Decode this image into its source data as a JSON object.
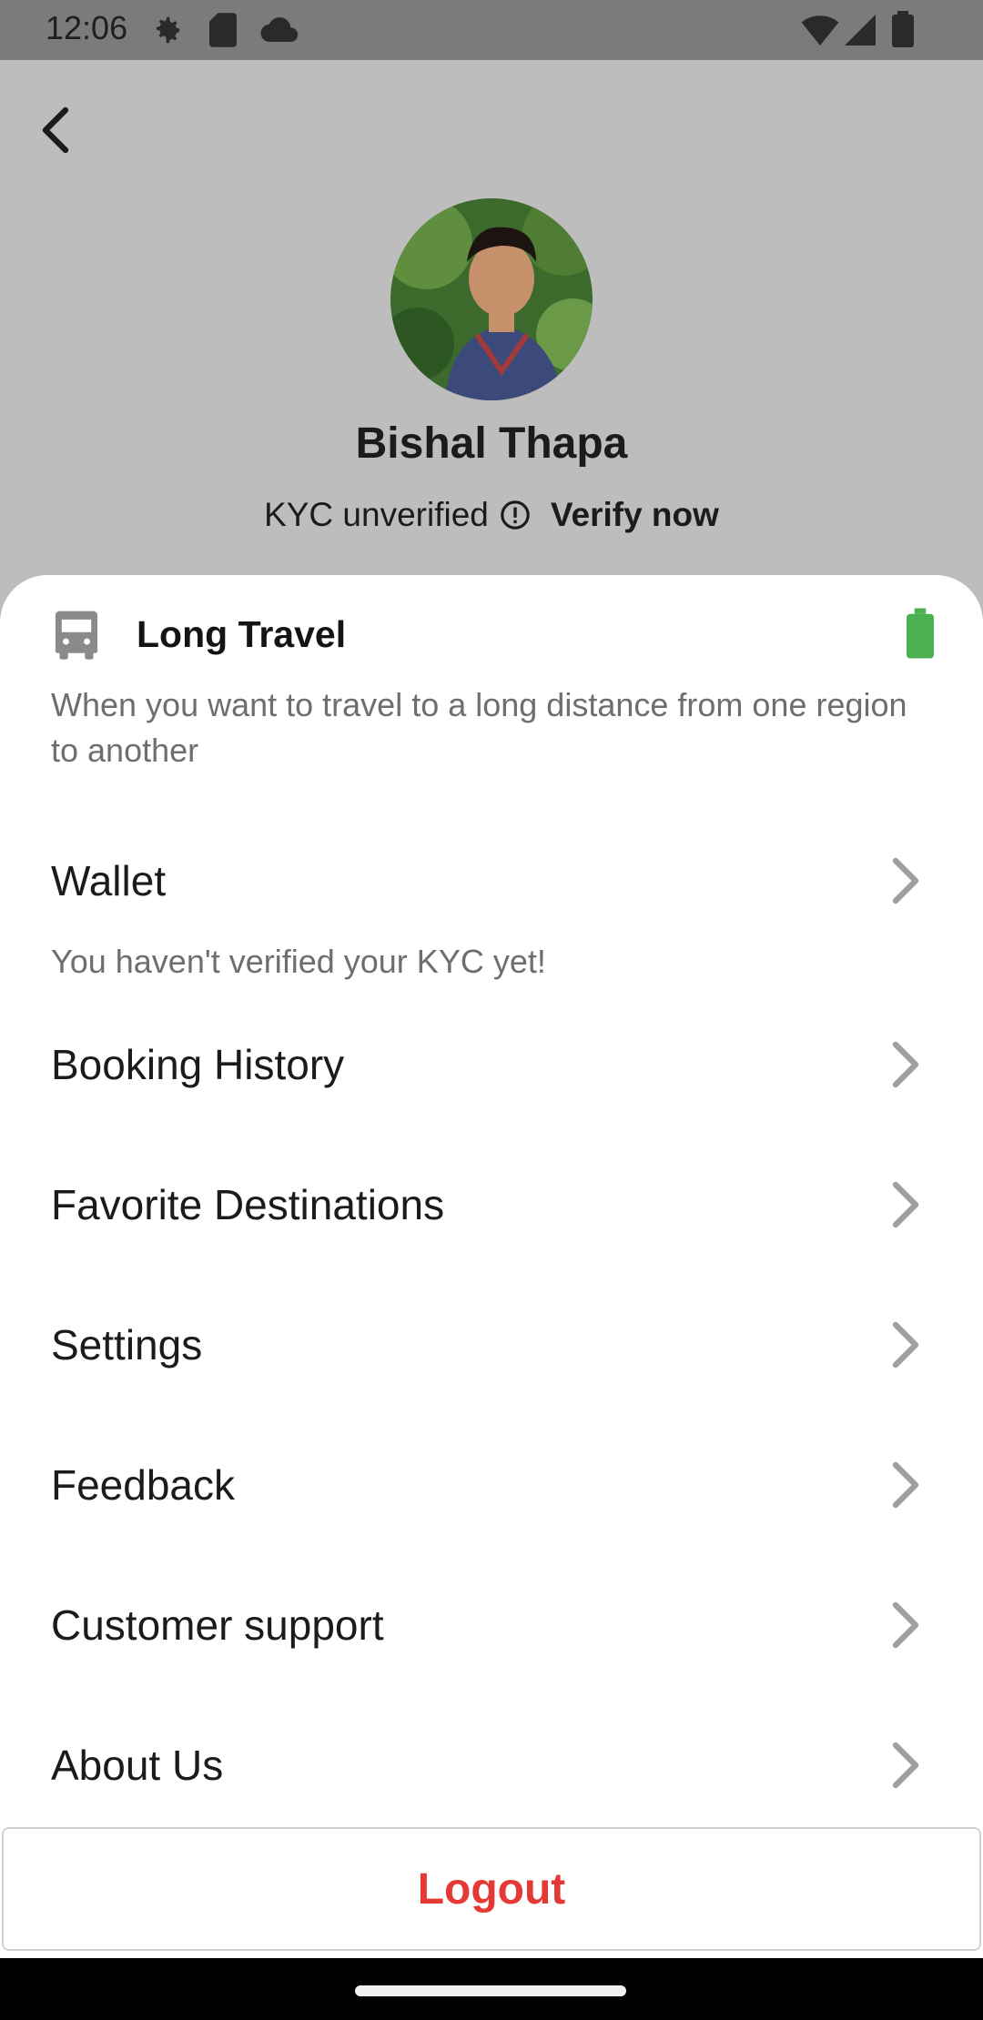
{
  "status_bar": {
    "time": "12:06",
    "icons": [
      "gear-icon",
      "sd-card-icon",
      "cloud-icon",
      "wifi-icon",
      "signal-icon",
      "battery-icon"
    ]
  },
  "header": {
    "back_icon": "back-arrow-icon",
    "name": "Bishal Thapa",
    "kyc_status": "KYC unverified",
    "kyc_icon": "info-circle-icon",
    "verify_label": "Verify now"
  },
  "travel": {
    "icon": "bus-icon",
    "title": "Long Travel",
    "description": "When you want to travel to a long distance from one region to another",
    "status_icon": "battery-icon",
    "accent_color": "#4caf50"
  },
  "menu": {
    "wallet": {
      "label": "Wallet",
      "note": "You haven't verified your KYC yet!"
    },
    "items": [
      {
        "label": "Booking History"
      },
      {
        "label": "Favorite Destinations"
      },
      {
        "label": "Settings"
      },
      {
        "label": "Feedback"
      },
      {
        "label": "Customer support"
      },
      {
        "label": "About Us"
      }
    ]
  },
  "logout": {
    "label": "Logout",
    "color": "#e53935"
  }
}
